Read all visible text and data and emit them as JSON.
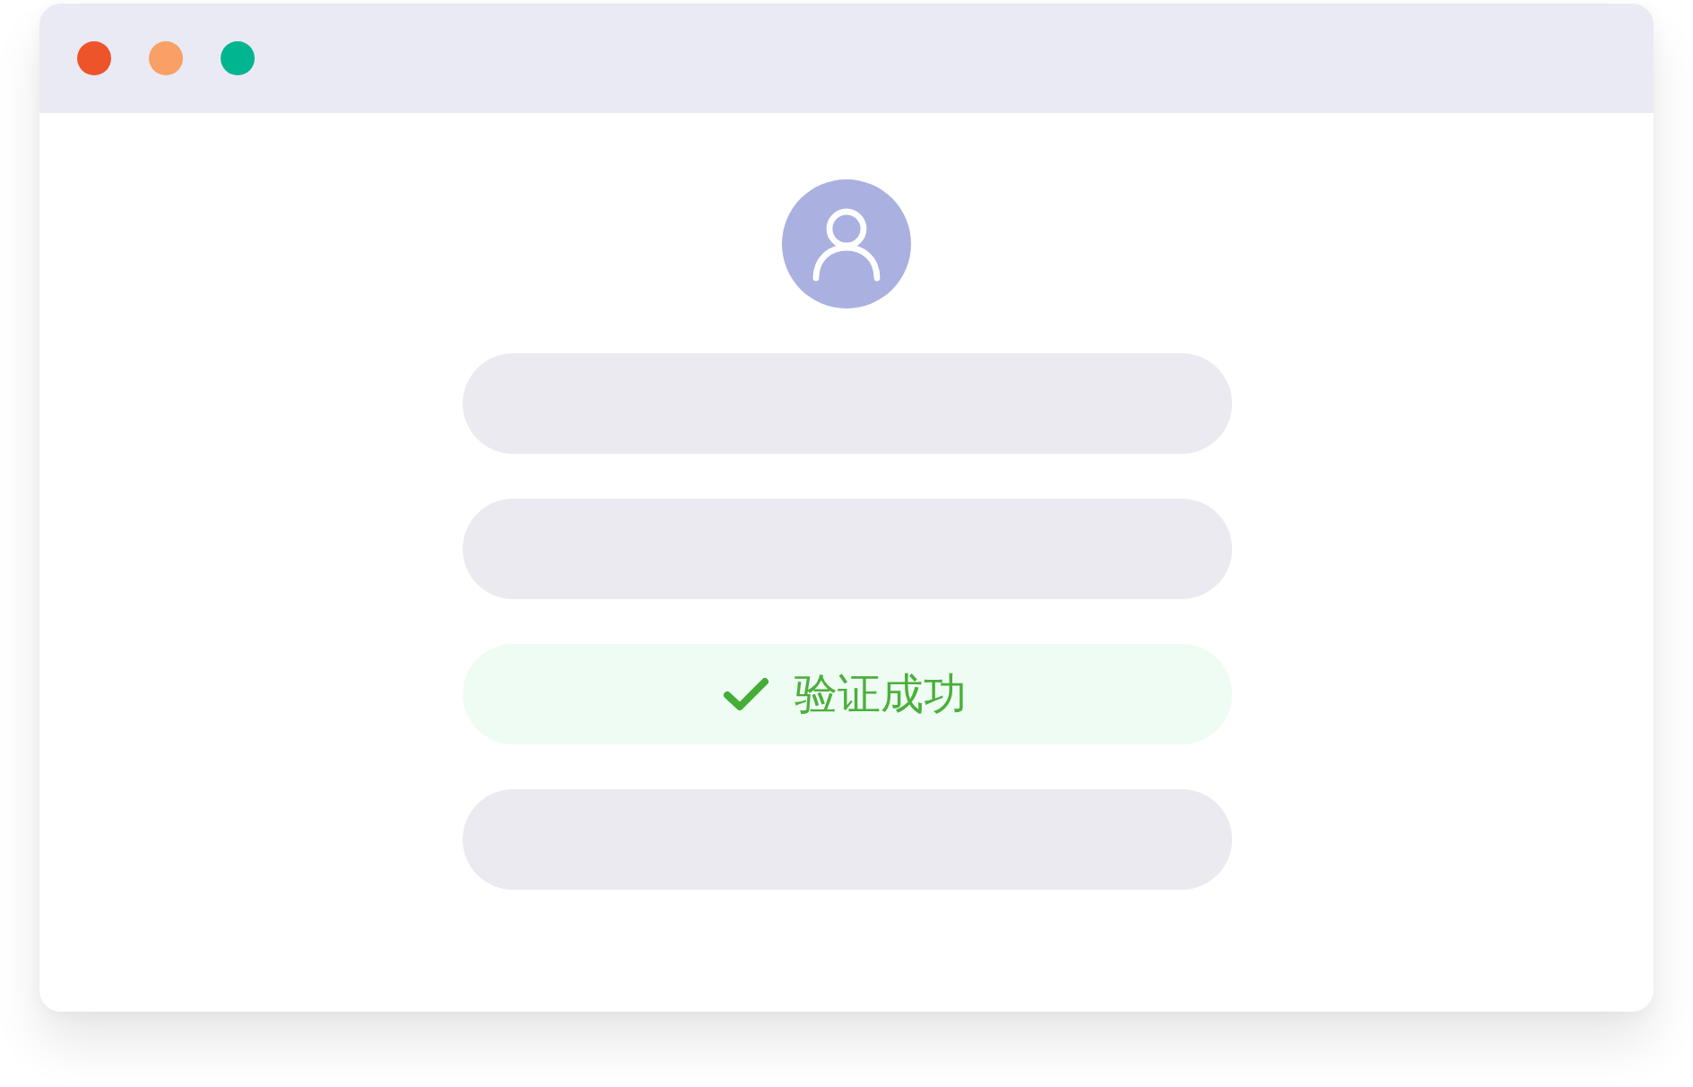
{
  "window": {
    "buttons": [
      {
        "color": "#ee5429"
      },
      {
        "color": "#f8a065"
      },
      {
        "color": "#00b58f"
      }
    ]
  },
  "form": {
    "rows": [
      {
        "kind": "input"
      },
      {
        "kind": "input"
      },
      {
        "kind": "status",
        "label": "验证成功",
        "verified": true
      },
      {
        "kind": "button"
      }
    ]
  }
}
